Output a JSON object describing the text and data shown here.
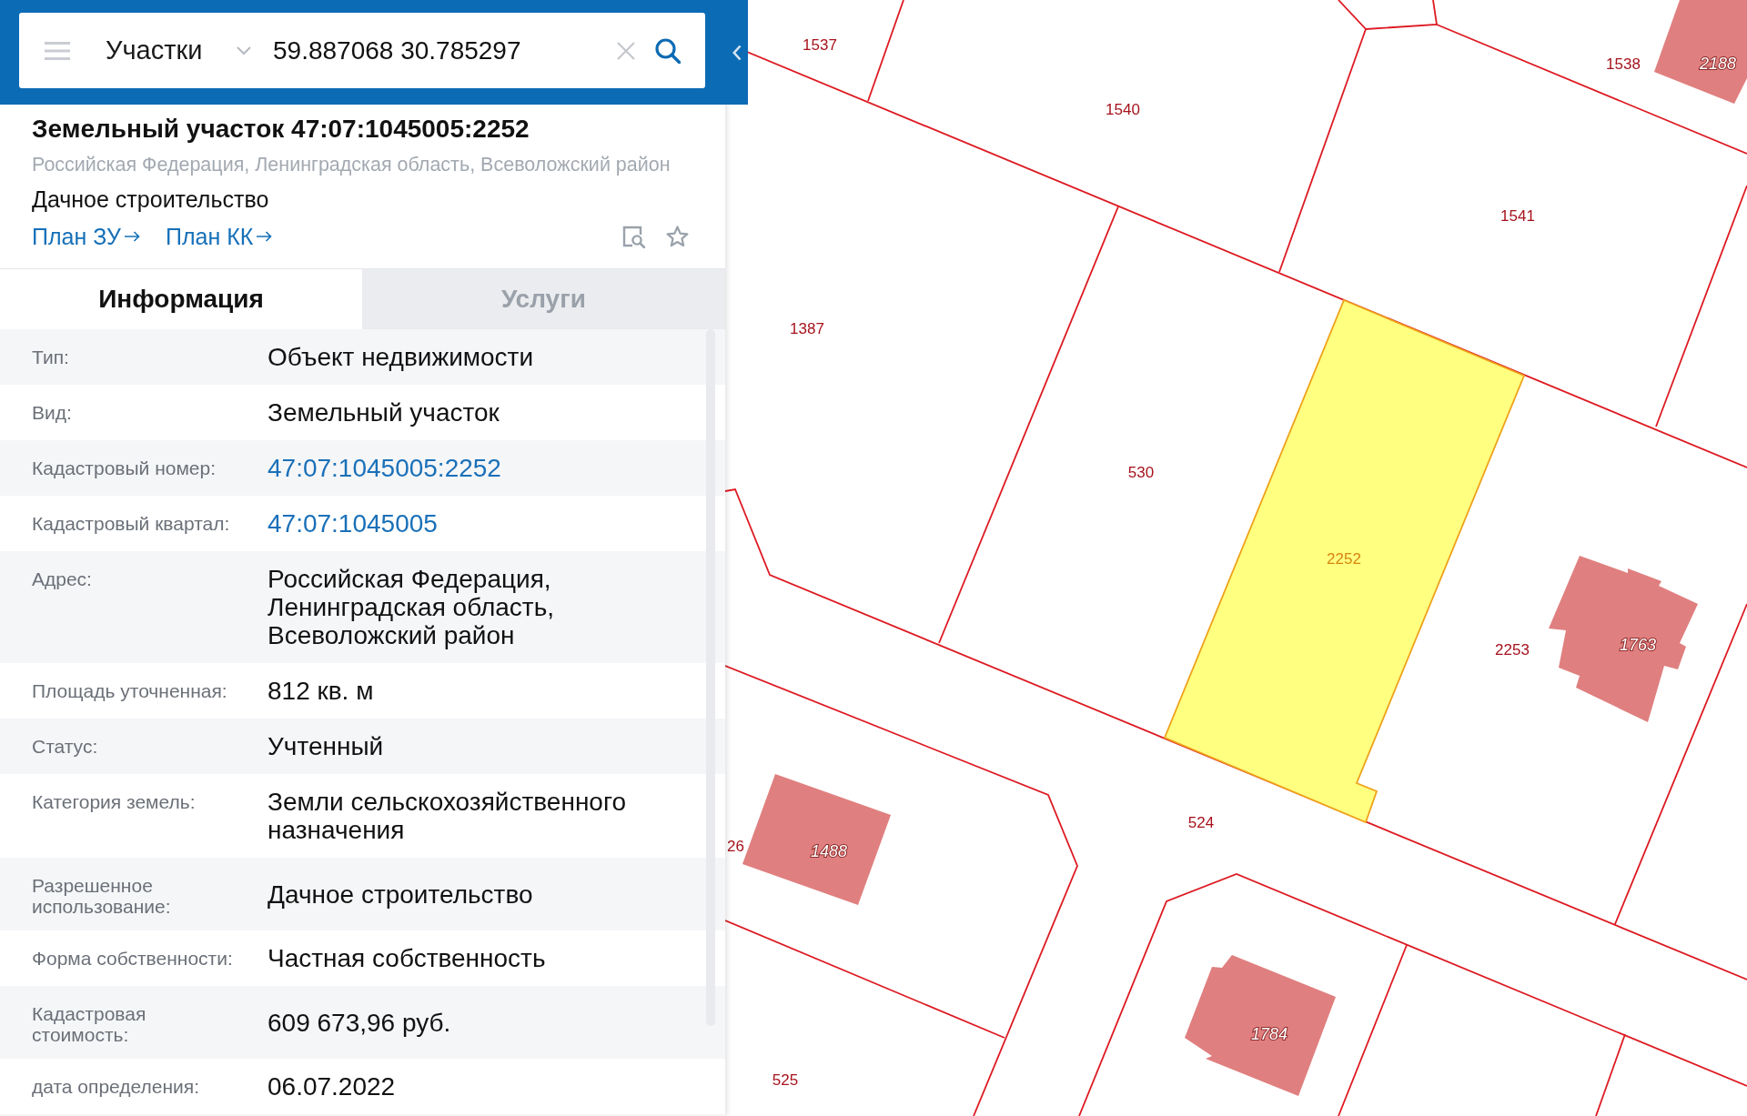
{
  "search_bar": {
    "layer": "Участки",
    "query": "59.887068 30.785297"
  },
  "card": {
    "title": "Земельный участок 47:07:1045005:2252",
    "address": "Российская Федерация, Ленинградская область, Всеволожский район",
    "purpose": "Дачное строительство",
    "links": [
      "План ЗУ",
      "План КК"
    ]
  },
  "tabs": [
    {
      "label": "Информация",
      "selected": true
    },
    {
      "label": "Услуги",
      "selected": false
    }
  ],
  "properties": [
    {
      "label": "Тип:",
      "value": "Объект недвижимости",
      "kind": "text"
    },
    {
      "label": "Вид:",
      "value": "Земельный участок",
      "kind": "text"
    },
    {
      "label": "Кадастровый номер:",
      "value": "47:07:1045005:2252",
      "kind": "link"
    },
    {
      "label": "Кадастровый квартал:",
      "value": "47:07:1045005",
      "kind": "link"
    },
    {
      "label": "Адрес:",
      "value": "Российская Федерация, Ленинградская область, Всеволожский район",
      "kind": "text"
    },
    {
      "label": "Площадь уточненная:",
      "value": "812 кв. м",
      "kind": "text"
    },
    {
      "label": "Статус:",
      "value": "Учтенный",
      "kind": "text"
    },
    {
      "label": "Категория земель:",
      "value": "Земли сельскохозяйственного назначения",
      "kind": "text"
    },
    {
      "label": "Разрешенное использование:",
      "value": "Дачное строительство",
      "kind": "text"
    },
    {
      "label": "Форма собственности:",
      "value": "Частная собственность",
      "kind": "text"
    },
    {
      "label": "Кадастровая стоимость:",
      "value": "609 673,96 руб.",
      "kind": "text"
    },
    {
      "label": "дата определения:",
      "value": "06.07.2022",
      "kind": "text"
    }
  ],
  "map": {
    "parcels": [
      {
        "number": "1537",
        "selected": false
      },
      {
        "number": "1540",
        "selected": false
      },
      {
        "number": "1538",
        "selected": false
      },
      {
        "number": "1541",
        "selected": false
      },
      {
        "number": "1387",
        "selected": false
      },
      {
        "number": "530",
        "selected": false
      },
      {
        "number": "2252",
        "selected": true
      },
      {
        "number": "2253",
        "selected": false
      },
      {
        "number": "524",
        "selected": false
      },
      {
        "number": "26",
        "selected": false
      },
      {
        "number": "525",
        "selected": false
      }
    ],
    "buildings": [
      {
        "number": "2188"
      },
      {
        "number": "1763"
      },
      {
        "number": "1488"
      },
      {
        "number": "1784"
      }
    ]
  }
}
